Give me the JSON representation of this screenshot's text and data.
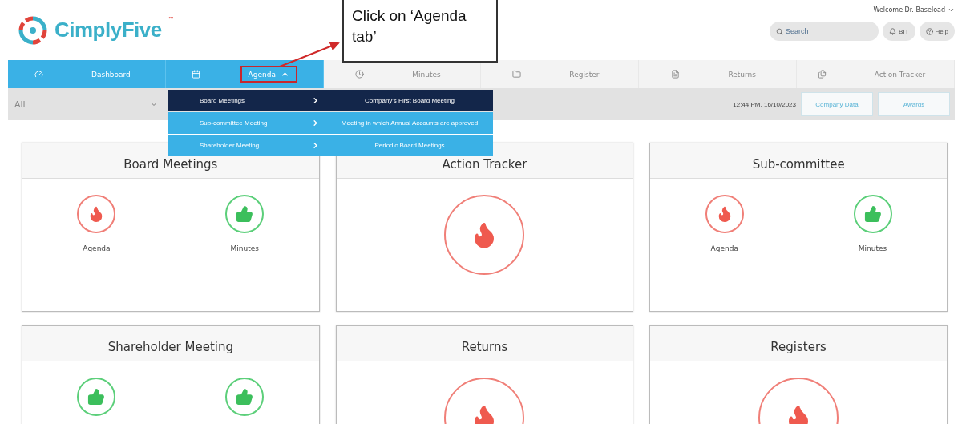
{
  "header": {
    "logo": "CimplyFive",
    "trademark": "™",
    "welcome": "Welcome Dr. Baseload",
    "search": {
      "placeholder": "Search"
    },
    "buttons": [
      {
        "kind": "bell",
        "label": "BIT"
      },
      {
        "kind": "help",
        "label": "Help"
      }
    ]
  },
  "annotation": {
    "text": "Click on ‘Agenda tab’"
  },
  "nav": [
    {
      "label": "Dashboard",
      "selected": true
    },
    {
      "label": "Agenda",
      "selected": true,
      "expanded": true,
      "highlighted": true
    },
    {
      "label": "Minutes",
      "selected": false
    },
    {
      "label": "Register",
      "selected": false
    },
    {
      "label": "Returns",
      "selected": false
    },
    {
      "label": "Action Tracker",
      "selected": false
    }
  ],
  "filter": {
    "value": "All",
    "timestamp": "12:44 PM, 16/10/2023",
    "buttons": [
      "Company Data",
      "Awards"
    ]
  },
  "menu": [
    {
      "label": "Board Meetings",
      "selected": true
    },
    {
      "label": "Sub-committee Meeting",
      "selected": false
    },
    {
      "label": "Shareholder Meeting",
      "selected": false
    }
  ],
  "submenu": [
    {
      "label": "Company's First Board Meeting",
      "selected": true
    },
    {
      "label": "Meeting in which Annual Accounts are approved",
      "selected": false
    },
    {
      "label": "Periodic Board Meetings",
      "selected": false
    }
  ],
  "cards": [
    {
      "title": "Board Meetings",
      "items": [
        {
          "kind": "flame",
          "label": "Agenda"
        },
        {
          "kind": "thumb",
          "label": "Minutes"
        }
      ]
    },
    {
      "title": "Action Tracker",
      "items": [
        {
          "kind": "flame-large"
        }
      ]
    },
    {
      "title": "Sub-committee",
      "items": [
        {
          "kind": "flame",
          "label": "Agenda"
        },
        {
          "kind": "thumb",
          "label": "Minutes"
        }
      ]
    },
    {
      "title": "Shareholder Meeting",
      "items": [
        {
          "kind": "thumb"
        },
        {
          "kind": "thumb"
        }
      ]
    },
    {
      "title": "Returns",
      "items": [
        {
          "kind": "flame-large"
        }
      ]
    },
    {
      "title": "Registers",
      "items": [
        {
          "kind": "flame-large"
        }
      ]
    }
  ]
}
